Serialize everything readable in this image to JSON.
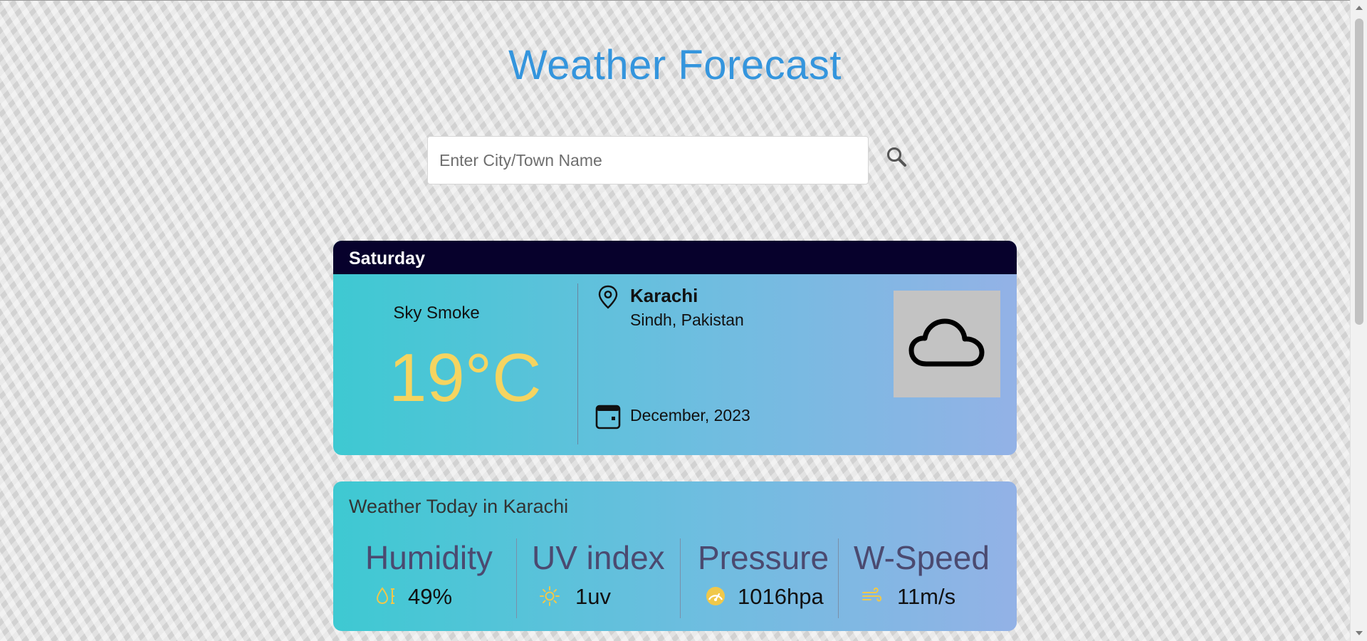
{
  "app": {
    "title": "Weather Forecast"
  },
  "search": {
    "placeholder": "Enter City/Town Name",
    "value": ""
  },
  "current": {
    "day": "Saturday",
    "condition": "Sky Smoke",
    "temperature": "19°C",
    "city": "Karachi",
    "region": "Sindh, Pakistan",
    "date": "December, 2023",
    "weather_icon": "cloud-icon"
  },
  "today": {
    "title": "Weather Today in Karachi",
    "stats": [
      {
        "label": "Humidity",
        "value": "49%",
        "icon": "humidity-icon"
      },
      {
        "label": "UV index",
        "value": "1uv",
        "icon": "sun-icon"
      },
      {
        "label": "Pressure",
        "value": "1016hpa",
        "icon": "gauge-icon"
      },
      {
        "label": "W-Speed",
        "value": "11m/s",
        "icon": "wind-icon"
      }
    ]
  },
  "colors": {
    "title": "#3495dd",
    "day_bar": "#07012c",
    "temperature": "#f5d460",
    "stat_label": "#4b4a70",
    "card_gradient_start": "#3ec9d2",
    "card_gradient_end": "#93b2e6"
  }
}
